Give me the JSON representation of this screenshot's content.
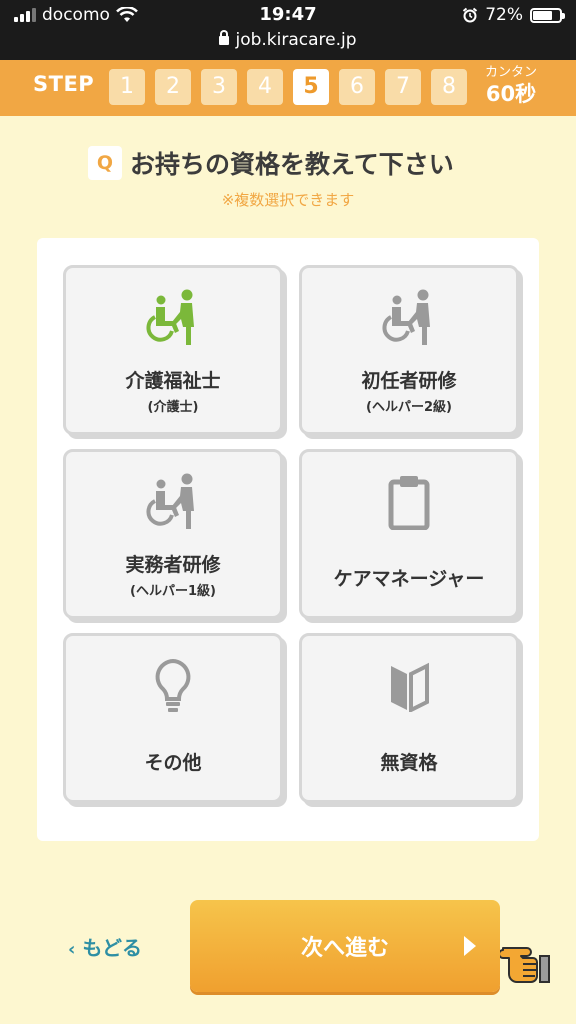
{
  "status_bar": {
    "carrier": "docomo",
    "time": "19:47",
    "url": "job.kiracare.jp",
    "battery": "72%",
    "battery_level": 0.72
  },
  "step_bar": {
    "label": "STEP",
    "steps": [
      "1",
      "2",
      "3",
      "4",
      "5",
      "6",
      "7",
      "8"
    ],
    "current_step": "5",
    "quick_line1": "カンタン",
    "quick_line2": "60秒"
  },
  "question": {
    "badge": "Q",
    "text": "お持ちの資格を教えて下さい",
    "note": "※複数選択できます"
  },
  "options": [
    {
      "label": "介護福祉士",
      "sub": "(介護士)",
      "icon": "caregiver-wheelchair-icon",
      "selected": true
    },
    {
      "label": "初任者研修",
      "sub": "(ヘルパー2級)",
      "icon": "caregiver-wheelchair-icon",
      "selected": false
    },
    {
      "label": "実務者研修",
      "sub": "(ヘルパー1級)",
      "icon": "caregiver-wheelchair-icon",
      "selected": false
    },
    {
      "label": "ケアマネージャー",
      "sub": "",
      "icon": "clipboard-icon",
      "selected": false
    },
    {
      "label": "その他",
      "sub": "",
      "icon": "lightbulb-icon",
      "selected": false
    },
    {
      "label": "無資格",
      "sub": "",
      "icon": "beginner-mark-icon",
      "selected": false
    }
  ],
  "nav": {
    "back_label": "もどる",
    "next_label": "次へ進む"
  },
  "colors": {
    "accent": "#f1a744",
    "background": "#fdf7d0",
    "selected_icon": "#7bb83a",
    "unselected_icon": "#9a9a9a",
    "back_link": "#2e8fa4"
  }
}
